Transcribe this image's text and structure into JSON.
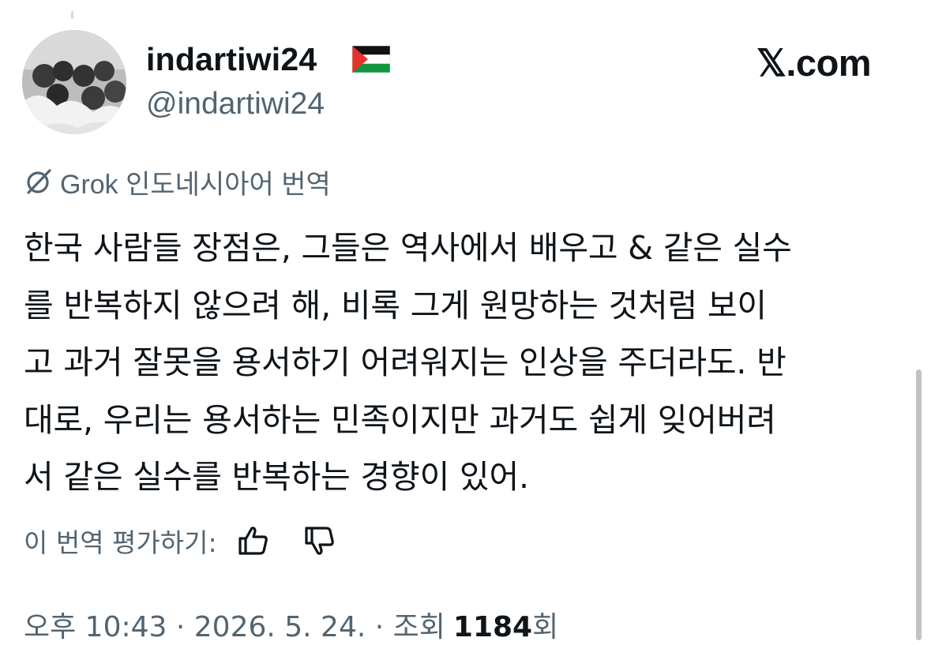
{
  "author": {
    "display_name": "indartiwi24",
    "flag_emoji": "palestine-flag",
    "handle": "@indartiwi24"
  },
  "brand": {
    "label": "𝕏.com"
  },
  "translation": {
    "label": "Grok 인도네시아어 번역",
    "icon": "grok-icon"
  },
  "tweet": {
    "lines": [
      "한국 사람들 장점은, 그들은 역사에서 배우고 & 같은 실수",
      "를 반복하지 않으려 해, 비록 그게 원망하는 것처럼 보이",
      "고 과거 잘못을 용서하기 어려워지는 인상을 주더라도. 반",
      "대로, 우리는 용서하는 민족이지만 과거도 쉽게 잊어버려",
      "서 같은 실수를 반복하는 경향이 있어."
    ]
  },
  "rating": {
    "label": "이 번역 평가하기:",
    "up_icon": "thumbs-up-icon",
    "down_icon": "thumbs-down-icon"
  },
  "meta": {
    "timestamp": "오후 10:43 · 2026. 5. 24. · 조회",
    "views": "1184",
    "views_suffix": "회"
  },
  "colors": {
    "text": "#0f1419",
    "muted": "#536471",
    "background": "#ffffff"
  }
}
